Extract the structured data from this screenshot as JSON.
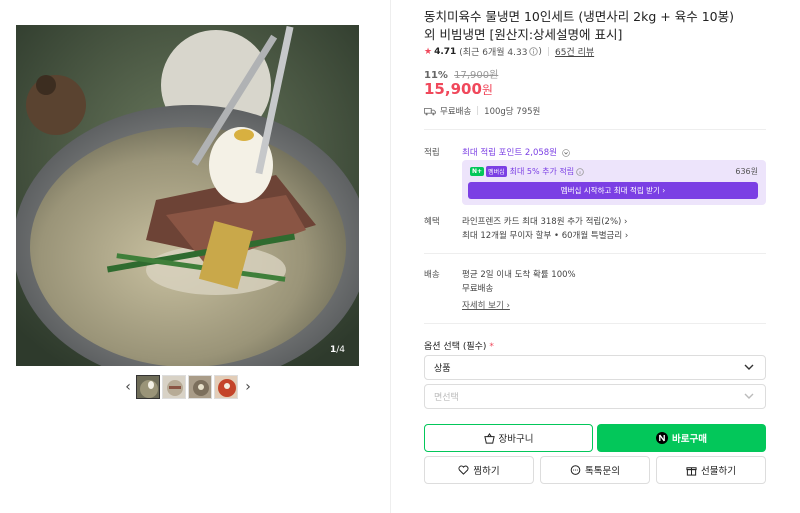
{
  "gallery": {
    "counter_current": "1",
    "counter_total": "/4",
    "prev_label": "‹",
    "next_label": "›"
  },
  "product": {
    "title": "동치미육수 물냉면 10인세트 (냉면사리 2kg + 육수 10봉) 외 비빔냉면 [원산지:상세설명에 표시]",
    "rating": "4.71",
    "rating_detail": "(최근 6개월 4.33",
    "reviews": "65건 리뷰",
    "discount_pct": "11%",
    "original_price": "17,900원",
    "price": "15,900",
    "price_unit": "원",
    "shipping_short": "무료배송",
    "unit_price": "100g당 795원"
  },
  "points": {
    "label": "적립",
    "max_points": "최대 적립 포인트 2,058원",
    "extra_label": "최대 5% 추가 적립",
    "badge_n": "N+",
    "badge_membership": "멤버십",
    "extra_amount": "636원",
    "membership_button": "멤버십 시작하고 최대 적립 받기 ›"
  },
  "benefits": {
    "label": "혜택",
    "line1": "라인프렌즈 카드 최대 318원 추가 적립(2%) ›",
    "line2": "최대 12개월 무이자 할부 • 60개월 특별금리 ›"
  },
  "delivery": {
    "label": "배송",
    "line1": "평균 2일 이내 도착 확률 100%",
    "line2": "무료배송",
    "detail_link": "자세히 보기 ›"
  },
  "options": {
    "heading": "옵션 선택 (필수)",
    "required_mark": "*",
    "select1": "상품",
    "select2": "면선택"
  },
  "actions": {
    "cart": "장바구니",
    "buy": "바로구매",
    "wish": "찜하기",
    "talk": "톡톡문의",
    "gift": "선물하기"
  },
  "colors": {
    "accent_green": "#03c75a",
    "price_red": "#f0485b",
    "membership_purple": "#7b3fe4"
  }
}
